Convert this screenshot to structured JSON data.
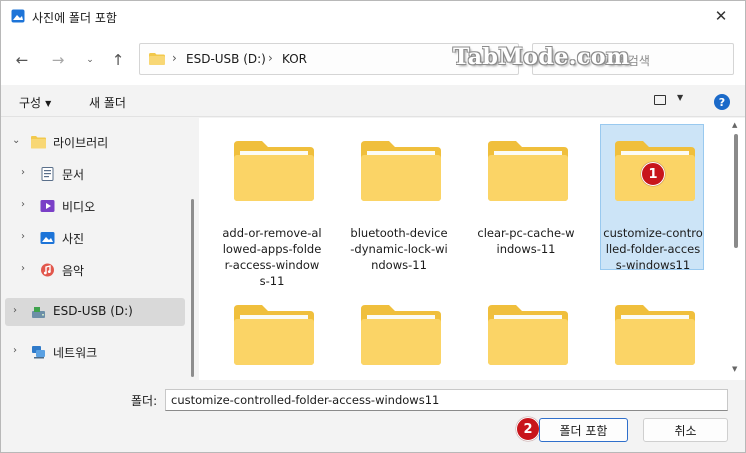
{
  "window": {
    "title": "사진에 폴더 포함"
  },
  "nav": {
    "breadcrumb": [
      "ESD-USB (D:)",
      "KOR"
    ],
    "search_placeholder": "KOR 검색",
    "watermark": "TabMode.com"
  },
  "toolbar": {
    "organize": "구성",
    "new_folder": "새 폴더"
  },
  "sidebar": {
    "items": [
      {
        "label": "라이브러리",
        "icon": "library-icon",
        "expanded": true
      },
      {
        "label": "문서",
        "icon": "documents-icon"
      },
      {
        "label": "비디오",
        "icon": "videos-icon"
      },
      {
        "label": "사진",
        "icon": "pictures-icon"
      },
      {
        "label": "음악",
        "icon": "music-icon"
      },
      {
        "label": "ESD-USB (D:)",
        "icon": "usb-drive-icon",
        "selected": true
      },
      {
        "label": "네트워크",
        "icon": "network-icon"
      }
    ]
  },
  "folders": [
    {
      "name": "add-or-remove-allowed-apps-folder-access-windows-11"
    },
    {
      "name": "bluetooth-device-dynamic-lock-windows-11"
    },
    {
      "name": "clear-pc-cache-windows-11"
    },
    {
      "name": "customize-controlled-folder-access-windows11",
      "selected": true
    },
    {
      "name": ""
    },
    {
      "name": ""
    },
    {
      "name": ""
    },
    {
      "name": ""
    }
  ],
  "badges": {
    "first": "1",
    "second": "2"
  },
  "bottom": {
    "folder_label": "폴더:",
    "folder_value": "customize-controlled-folder-access-windows11",
    "include_button": "폴더 포함",
    "cancel_button": "취소"
  },
  "colors": {
    "accent": "#1b6ac9",
    "selection": "#cce4f7",
    "badge": "#c8151b",
    "folder": "#f8d775"
  }
}
